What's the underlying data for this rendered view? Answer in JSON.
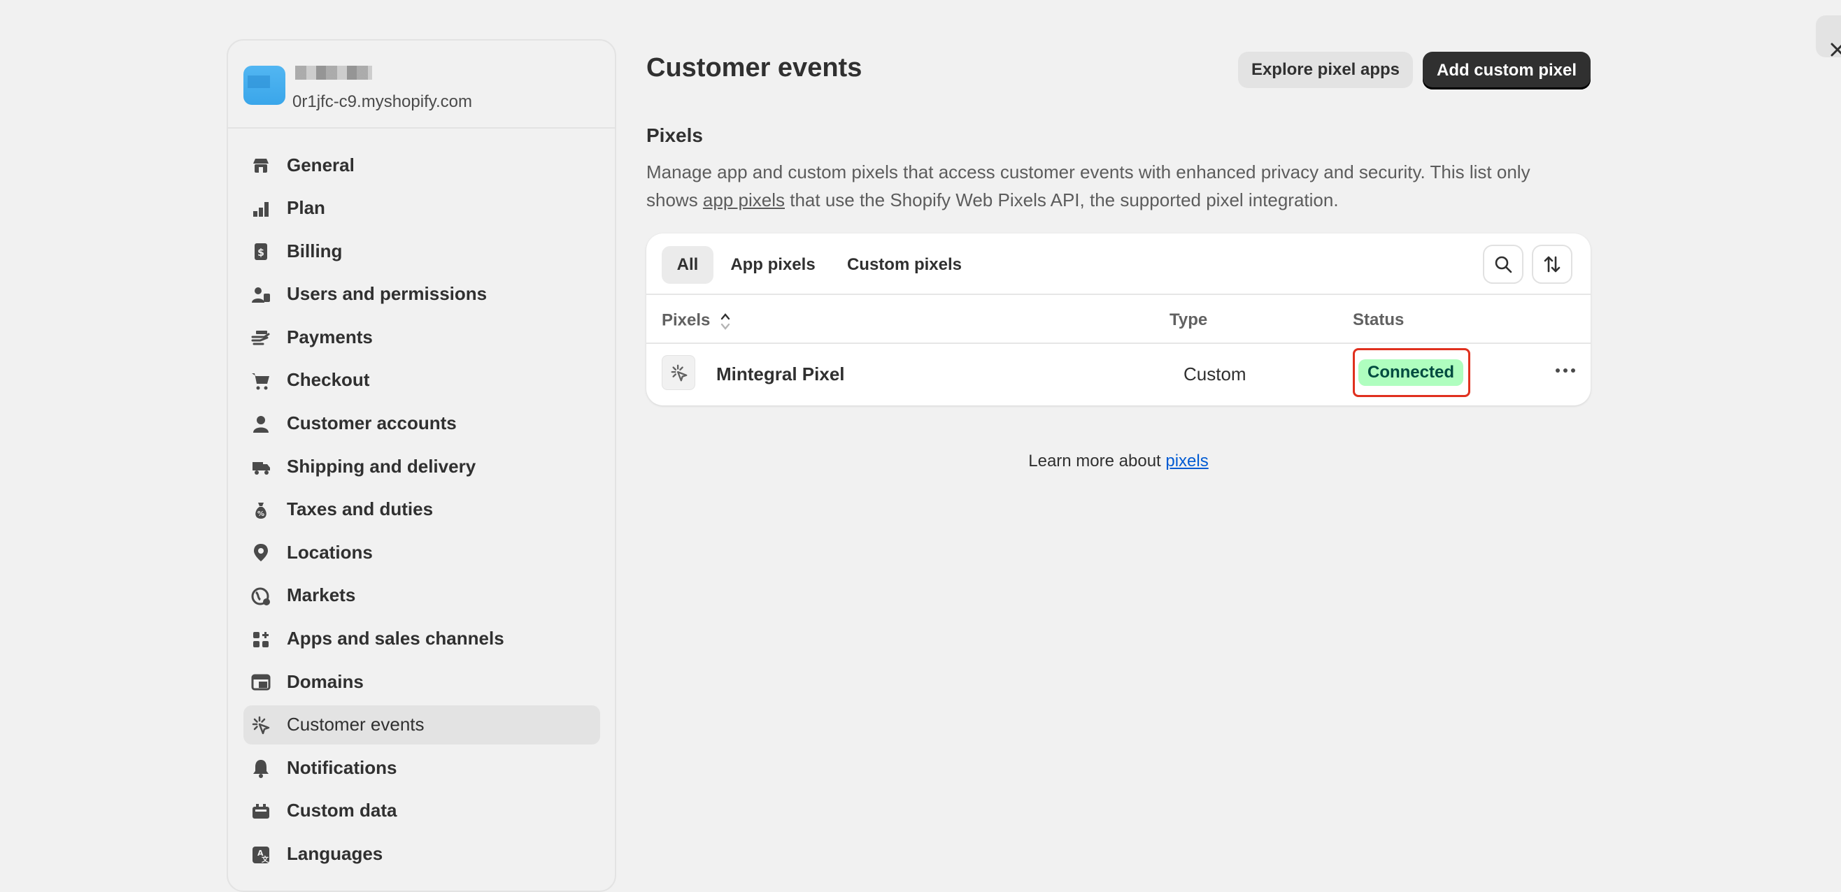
{
  "store": {
    "domain": "0r1jfc-c9.myshopify.com"
  },
  "sidebar": {
    "items": [
      {
        "label": "General",
        "icon": "store-icon"
      },
      {
        "label": "Plan",
        "icon": "plan-chart-icon"
      },
      {
        "label": "Billing",
        "icon": "billing-icon"
      },
      {
        "label": "Users and permissions",
        "icon": "users-icon"
      },
      {
        "label": "Payments",
        "icon": "payments-hand-icon"
      },
      {
        "label": "Checkout",
        "icon": "cart-icon"
      },
      {
        "label": "Customer accounts",
        "icon": "person-icon"
      },
      {
        "label": "Shipping and delivery",
        "icon": "truck-icon"
      },
      {
        "label": "Taxes and duties",
        "icon": "tax-bag-icon"
      },
      {
        "label": "Locations",
        "icon": "location-pin-icon"
      },
      {
        "label": "Markets",
        "icon": "globe-icon"
      },
      {
        "label": "Apps and sales channels",
        "icon": "apps-icon"
      },
      {
        "label": "Domains",
        "icon": "domains-icon"
      },
      {
        "label": "Customer events",
        "icon": "cursor-sparkle-icon",
        "active": true
      },
      {
        "label": "Notifications",
        "icon": "bell-icon"
      },
      {
        "label": "Custom data",
        "icon": "custom-data-icon"
      },
      {
        "label": "Languages",
        "icon": "language-icon"
      }
    ]
  },
  "header": {
    "title": "Customer events",
    "explore_label": "Explore pixel apps",
    "add_label": "Add custom pixel"
  },
  "pixels_section": {
    "title": "Pixels",
    "desc_part1": "Manage app and custom pixels that access customer events with enhanced privacy and security. This list only shows ",
    "desc_link": "app pixels",
    "desc_part2": " that use the Shopify Web Pixels API, the supported pixel integration."
  },
  "tabs": [
    "All",
    "App pixels",
    "Custom pixels"
  ],
  "table": {
    "headers": {
      "pixels": "Pixels",
      "type": "Type",
      "status": "Status"
    },
    "rows": [
      {
        "name": "Mintegral Pixel",
        "type": "Custom",
        "status": "Connected"
      }
    ]
  },
  "footer": {
    "learn_prefix": "Learn more about ",
    "learn_link": "pixels"
  },
  "colors": {
    "background": "#f1f1f1",
    "primary_button": "#303030",
    "badge_success_bg": "#affebf",
    "badge_success_text": "#014b40",
    "highlight_frame": "#e0301e",
    "link": "#005bd3"
  }
}
